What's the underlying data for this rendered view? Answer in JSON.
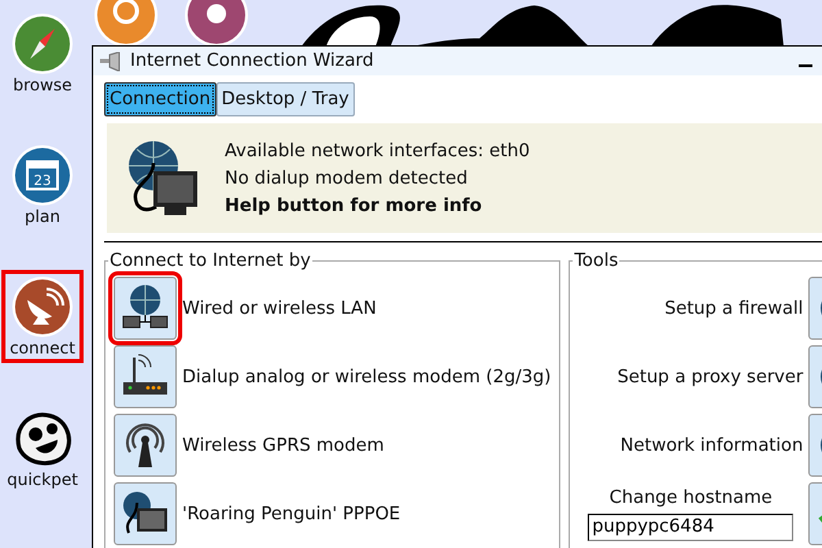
{
  "desktop": {
    "icons": [
      {
        "label": "browse",
        "highlighted": false
      },
      {
        "label": "plan",
        "highlighted": false,
        "icon_text": "23"
      },
      {
        "label": "connect",
        "highlighted": true
      },
      {
        "label": "quickpet",
        "highlighted": false
      }
    ]
  },
  "window": {
    "title": "Internet Connection Wizard",
    "tabs": [
      {
        "label": "Connection",
        "selected": true
      },
      {
        "label": "Desktop / Tray",
        "selected": false
      }
    ],
    "info": {
      "lines": [
        "Available network interfaces: eth0",
        "No dialup modem detected"
      ],
      "help": "Help button for more info"
    },
    "connect": {
      "title": "Connect to Internet by",
      "options": [
        {
          "label": "Wired or wireless LAN",
          "highlighted": true
        },
        {
          "label": "Dialup analog or wireless modem (2g/3g)",
          "highlighted": false
        },
        {
          "label": "Wireless GPRS modem",
          "highlighted": false
        },
        {
          "label": "'Roaring Penguin' PPPOE",
          "highlighted": false
        }
      ]
    },
    "tools": {
      "title": "Tools",
      "items": [
        {
          "label": "Setup a firewall"
        },
        {
          "label": "Setup a proxy server"
        },
        {
          "label": "Network information"
        }
      ],
      "hostname": {
        "label": "Change hostname",
        "value": "puppypc6484"
      }
    }
  }
}
